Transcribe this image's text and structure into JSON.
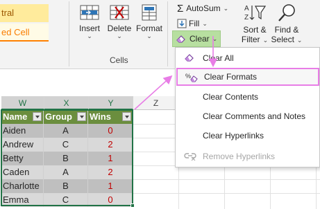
{
  "ribbon": {
    "styles": {
      "neutral": "tral",
      "linked_cell": "ed Cell"
    },
    "cells_group": {
      "label": "Cells",
      "insert": "Insert",
      "delete": "Delete",
      "format": "Format"
    },
    "editing": {
      "autosum": "AutoSum",
      "fill": "Fill",
      "clear": "Clear",
      "sort_filter_line1": "Sort &",
      "sort_filter_line2": "Filter",
      "find_select_line1": "Find &",
      "find_select_line2": "Select"
    }
  },
  "clear_menu": {
    "items": [
      {
        "label": "Clear All",
        "icon": "eraser-icon"
      },
      {
        "label": "Clear Formats",
        "icon": "clear-formats-icon"
      },
      {
        "label": "Clear Contents",
        "icon": ""
      },
      {
        "label": "Clear Comments and Notes",
        "icon": ""
      },
      {
        "label": "Clear Hyperlinks",
        "icon": ""
      },
      {
        "label": "Remove Hyperlinks",
        "icon": "remove-link-icon"
      }
    ],
    "highlighted": "Clear Formats"
  },
  "sheet": {
    "columns": [
      "W",
      "X",
      "Y",
      "Z"
    ],
    "table": {
      "headers": [
        "Name",
        "Group",
        "Wins"
      ],
      "rows": [
        [
          "Aiden",
          "A",
          "0"
        ],
        [
          "Andrew",
          "C",
          "2"
        ],
        [
          "Betty",
          "B",
          "1"
        ],
        [
          "Caden",
          "A",
          "2"
        ],
        [
          "Charlotte",
          "B",
          "1"
        ],
        [
          "Emma",
          "C",
          "0"
        ]
      ]
    }
  },
  "colors": {
    "accent_green": "#217346",
    "header_fill": "#6b8e3e",
    "highlight_pink": "#e87de6",
    "clear_button": "#b7dfa0",
    "wins_red": "#c00000"
  }
}
